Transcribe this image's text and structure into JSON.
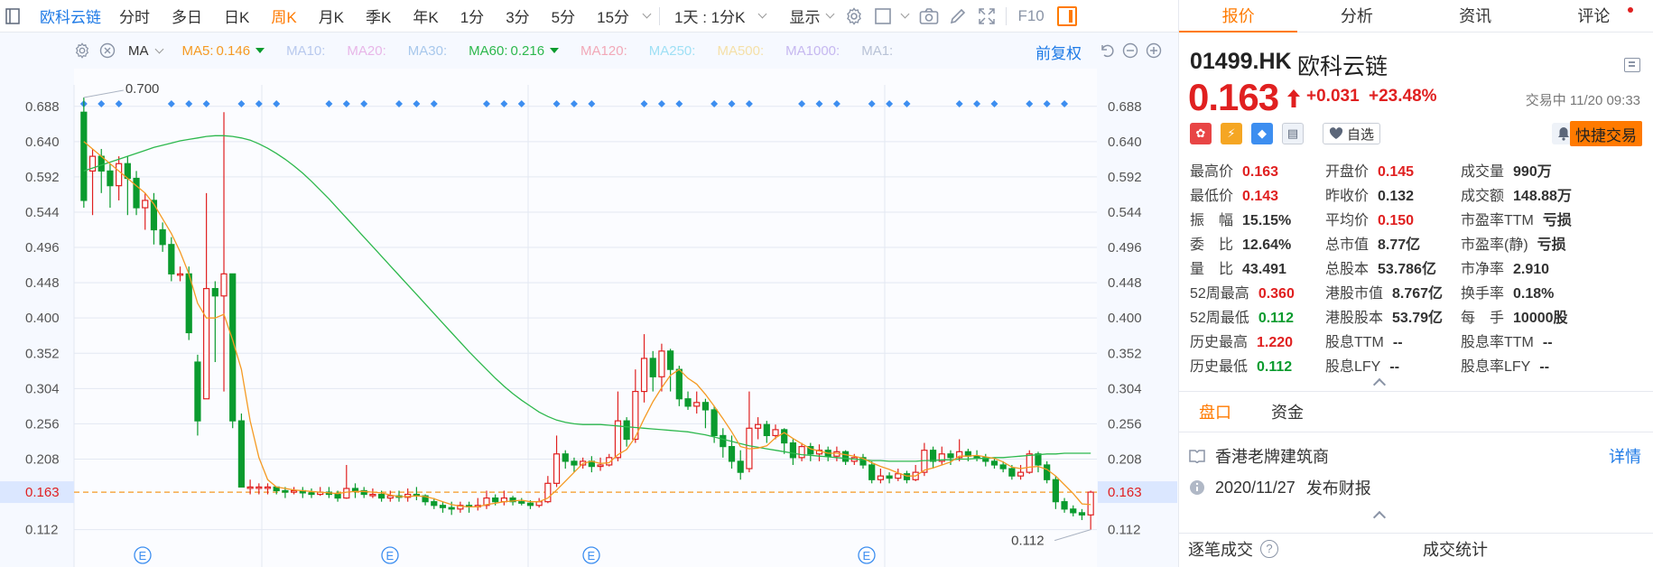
{
  "toolbar": {
    "stock_name": "欧科云链",
    "periods": [
      "分时",
      "多日",
      "日K",
      "周K",
      "月K",
      "季K",
      "年K",
      "1分",
      "3分",
      "5分",
      "15分"
    ],
    "active_period": "周K",
    "range_label": "1天 : 1分K",
    "display_label": "显示",
    "f10_label": "F10"
  },
  "ma_bar": {
    "label": "MA",
    "items": [
      {
        "label": "MA5:",
        "value": "0.146",
        "color": "#f59a23",
        "arrow": true
      },
      {
        "label": "MA10:",
        "value": "",
        "color": "#b8c9ee",
        "arrow": false
      },
      {
        "label": "MA20:",
        "value": "",
        "color": "#e8b6e8",
        "arrow": false
      },
      {
        "label": "MA30:",
        "value": "",
        "color": "#a8c8ec",
        "arrow": false
      },
      {
        "label": "MA60:",
        "value": "0.216",
        "color": "#2db84d",
        "arrow": true
      },
      {
        "label": "MA120:",
        "value": "",
        "color": "#f2a9b8",
        "arrow": false
      },
      {
        "label": "MA250:",
        "value": "",
        "color": "#9fe0f5",
        "arrow": false
      },
      {
        "label": "MA500:",
        "value": "",
        "color": "#f5e0a8",
        "arrow": false
      },
      {
        "label": "MA1000:",
        "value": "",
        "color": "#c6b8f0",
        "arrow": false
      },
      {
        "label": "MA1:",
        "value": "",
        "color": "#b8c2d6",
        "arrow": false
      }
    ],
    "adjust_label": "前复权"
  },
  "chart_data": {
    "type": "candlestick",
    "period": "周K",
    "y_ticks": [
      "0.688",
      "0.640",
      "0.592",
      "0.544",
      "0.496",
      "0.448",
      "0.400",
      "0.352",
      "0.304",
      "0.256",
      "0.208",
      "0.163",
      "0.112"
    ],
    "y_ticks_num": [
      0.688,
      0.64,
      0.592,
      0.544,
      0.496,
      0.448,
      0.4,
      0.352,
      0.304,
      0.256,
      0.208,
      0.163,
      0.112
    ],
    "ylim": [
      0.098,
      0.7
    ],
    "current_price": "0.163",
    "high_label": "0.700",
    "low_label": "0.112",
    "event_marker_label": "E",
    "candles": [
      [
        0.68,
        0.56,
        0.7,
        0.55
      ],
      [
        0.6,
        0.62,
        0.63,
        0.54
      ],
      [
        0.62,
        0.6,
        0.63,
        0.57
      ],
      [
        0.6,
        0.58,
        0.61,
        0.55
      ],
      [
        0.58,
        0.61,
        0.62,
        0.56
      ],
      [
        0.61,
        0.59,
        0.62,
        0.54
      ],
      [
        0.59,
        0.55,
        0.6,
        0.54
      ],
      [
        0.55,
        0.56,
        0.57,
        0.52
      ],
      [
        0.56,
        0.52,
        0.57,
        0.5
      ],
      [
        0.52,
        0.5,
        0.53,
        0.49
      ],
      [
        0.5,
        0.46,
        0.51,
        0.45
      ],
      [
        0.46,
        0.46,
        0.47,
        0.45
      ],
      [
        0.46,
        0.38,
        0.47,
        0.37
      ],
      [
        0.34,
        0.26,
        0.35,
        0.24
      ],
      [
        0.29,
        0.44,
        0.57,
        0.29
      ],
      [
        0.44,
        0.43,
        0.45,
        0.34
      ],
      [
        0.43,
        0.46,
        0.68,
        0.3
      ],
      [
        0.46,
        0.26,
        0.46,
        0.25
      ],
      [
        0.26,
        0.17,
        0.27,
        0.17
      ],
      [
        0.17,
        0.17,
        0.18,
        0.16
      ],
      [
        0.17,
        0.17,
        0.175,
        0.16
      ],
      [
        0.17,
        0.17,
        0.175,
        0.16
      ],
      [
        0.17,
        0.165,
        0.17,
        0.16
      ],
      [
        0.165,
        0.163,
        0.17,
        0.155
      ],
      [
        0.163,
        0.165,
        0.17,
        0.16
      ],
      [
        0.165,
        0.162,
        0.17,
        0.155
      ],
      [
        0.162,
        0.16,
        0.168,
        0.155
      ],
      [
        0.16,
        0.163,
        0.17,
        0.158
      ],
      [
        0.163,
        0.16,
        0.17,
        0.155
      ],
      [
        0.16,
        0.155,
        0.165,
        0.15
      ],
      [
        0.155,
        0.168,
        0.2,
        0.154
      ],
      [
        0.168,
        0.165,
        0.175,
        0.155
      ],
      [
        0.165,
        0.16,
        0.17,
        0.155
      ],
      [
        0.16,
        0.16,
        0.168,
        0.155
      ],
      [
        0.16,
        0.155,
        0.165,
        0.15
      ],
      [
        0.155,
        0.158,
        0.165,
        0.15
      ],
      [
        0.158,
        0.156,
        0.165,
        0.15
      ],
      [
        0.156,
        0.16,
        0.168,
        0.15
      ],
      [
        0.16,
        0.158,
        0.17,
        0.152
      ],
      [
        0.158,
        0.15,
        0.16,
        0.145
      ],
      [
        0.15,
        0.145,
        0.155,
        0.14
      ],
      [
        0.145,
        0.142,
        0.15,
        0.135
      ],
      [
        0.142,
        0.14,
        0.15,
        0.132
      ],
      [
        0.14,
        0.145,
        0.15,
        0.135
      ],
      [
        0.145,
        0.143,
        0.15,
        0.135
      ],
      [
        0.143,
        0.145,
        0.155,
        0.138
      ],
      [
        0.145,
        0.155,
        0.165,
        0.14
      ],
      [
        0.155,
        0.15,
        0.16,
        0.145
      ],
      [
        0.15,
        0.155,
        0.165,
        0.145
      ],
      [
        0.155,
        0.15,
        0.158,
        0.145
      ],
      [
        0.15,
        0.148,
        0.155,
        0.145
      ],
      [
        0.148,
        0.145,
        0.152,
        0.14
      ],
      [
        0.145,
        0.15,
        0.155,
        0.142
      ],
      [
        0.15,
        0.175,
        0.185,
        0.148
      ],
      [
        0.175,
        0.215,
        0.24,
        0.17
      ],
      [
        0.215,
        0.205,
        0.22,
        0.195
      ],
      [
        0.205,
        0.2,
        0.21,
        0.19
      ],
      [
        0.2,
        0.205,
        0.21,
        0.195
      ],
      [
        0.205,
        0.198,
        0.212,
        0.19
      ],
      [
        0.198,
        0.2,
        0.21,
        0.192
      ],
      [
        0.2,
        0.21,
        0.215,
        0.198
      ],
      [
        0.21,
        0.26,
        0.3,
        0.205
      ],
      [
        0.26,
        0.235,
        0.265,
        0.225
      ],
      [
        0.235,
        0.3,
        0.33,
        0.23
      ],
      [
        0.3,
        0.345,
        0.378,
        0.285
      ],
      [
        0.345,
        0.32,
        0.355,
        0.3
      ],
      [
        0.32,
        0.355,
        0.365,
        0.3
      ],
      [
        0.355,
        0.33,
        0.358,
        0.3
      ],
      [
        0.33,
        0.29,
        0.335,
        0.28
      ],
      [
        0.29,
        0.28,
        0.3,
        0.275
      ],
      [
        0.28,
        0.285,
        0.3,
        0.27
      ],
      [
        0.285,
        0.275,
        0.29,
        0.25
      ],
      [
        0.275,
        0.24,
        0.28,
        0.23
      ],
      [
        0.24,
        0.225,
        0.25,
        0.21
      ],
      [
        0.225,
        0.205,
        0.24,
        0.195
      ],
      [
        0.205,
        0.19,
        0.22,
        0.18
      ],
      [
        0.195,
        0.25,
        0.3,
        0.19
      ],
      [
        0.25,
        0.255,
        0.265,
        0.235
      ],
      [
        0.255,
        0.24,
        0.26,
        0.23
      ],
      [
        0.24,
        0.248,
        0.255,
        0.235
      ],
      [
        0.248,
        0.23,
        0.25,
        0.215
      ],
      [
        0.23,
        0.21,
        0.235,
        0.2
      ],
      [
        0.21,
        0.225,
        0.23,
        0.205
      ],
      [
        0.225,
        0.215,
        0.23,
        0.205
      ],
      [
        0.215,
        0.22,
        0.228,
        0.205
      ],
      [
        0.22,
        0.212,
        0.225,
        0.205
      ],
      [
        0.212,
        0.218,
        0.225,
        0.205
      ],
      [
        0.218,
        0.205,
        0.22,
        0.2
      ],
      [
        0.205,
        0.21,
        0.215,
        0.2
      ],
      [
        0.21,
        0.2,
        0.215,
        0.195
      ],
      [
        0.2,
        0.18,
        0.205,
        0.175
      ],
      [
        0.18,
        0.185,
        0.195,
        0.175
      ],
      [
        0.185,
        0.182,
        0.19,
        0.175
      ],
      [
        0.182,
        0.188,
        0.195,
        0.178
      ],
      [
        0.188,
        0.18,
        0.192,
        0.175
      ],
      [
        0.18,
        0.19,
        0.2,
        0.178
      ],
      [
        0.19,
        0.22,
        0.23,
        0.185
      ],
      [
        0.22,
        0.205,
        0.225,
        0.195
      ],
      [
        0.205,
        0.215,
        0.225,
        0.2
      ],
      [
        0.215,
        0.21,
        0.22,
        0.2
      ],
      [
        0.21,
        0.218,
        0.235,
        0.205
      ],
      [
        0.218,
        0.212,
        0.222,
        0.205
      ],
      [
        0.212,
        0.21,
        0.22,
        0.205
      ],
      [
        0.21,
        0.205,
        0.215,
        0.198
      ],
      [
        0.205,
        0.2,
        0.21,
        0.195
      ],
      [
        0.2,
        0.195,
        0.205,
        0.19
      ],
      [
        0.195,
        0.185,
        0.2,
        0.18
      ],
      [
        0.185,
        0.19,
        0.2,
        0.18
      ],
      [
        0.19,
        0.215,
        0.22,
        0.188
      ],
      [
        0.215,
        0.2,
        0.218,
        0.19
      ],
      [
        0.2,
        0.18,
        0.205,
        0.175
      ],
      [
        0.18,
        0.15,
        0.185,
        0.14
      ],
      [
        0.15,
        0.14,
        0.155,
        0.135
      ],
      [
        0.14,
        0.135,
        0.145,
        0.13
      ],
      [
        0.135,
        0.132,
        0.14,
        0.125
      ],
      [
        0.132,
        0.163,
        0.165,
        0.112
      ]
    ],
    "ma5": [
      0.64,
      0.63,
      0.62,
      0.61,
      0.6,
      0.59,
      0.58,
      0.57,
      0.555,
      0.535,
      0.515,
      0.49,
      0.46,
      0.42,
      0.4,
      0.4,
      0.405,
      0.37,
      0.33,
      0.26,
      0.21,
      0.18,
      0.17,
      0.168,
      0.166,
      0.165,
      0.164,
      0.163,
      0.162,
      0.161,
      0.163,
      0.164,
      0.164,
      0.163,
      0.162,
      0.159,
      0.157,
      0.157,
      0.158,
      0.157,
      0.154,
      0.15,
      0.146,
      0.144,
      0.143,
      0.143,
      0.146,
      0.148,
      0.15,
      0.151,
      0.152,
      0.15,
      0.15,
      0.155,
      0.166,
      0.178,
      0.19,
      0.202,
      0.205,
      0.202,
      0.203,
      0.214,
      0.221,
      0.238,
      0.263,
      0.286,
      0.305,
      0.322,
      0.33,
      0.318,
      0.31,
      0.296,
      0.28,
      0.263,
      0.245,
      0.225,
      0.222,
      0.223,
      0.226,
      0.237,
      0.244,
      0.236,
      0.229,
      0.222,
      0.219,
      0.216,
      0.216,
      0.214,
      0.212,
      0.209,
      0.203,
      0.198,
      0.194,
      0.189,
      0.185,
      0.185,
      0.193,
      0.196,
      0.2,
      0.204,
      0.212,
      0.212,
      0.213,
      0.211,
      0.209,
      0.204,
      0.197,
      0.195,
      0.197,
      0.198,
      0.194,
      0.185,
      0.173,
      0.161,
      0.147,
      0.146
    ],
    "ma60": [
      0.6,
      0.604,
      0.608,
      0.612,
      0.616,
      0.62,
      0.624,
      0.628,
      0.632,
      0.635,
      0.638,
      0.641,
      0.643,
      0.645,
      0.647,
      0.648,
      0.648,
      0.647,
      0.645,
      0.642,
      0.637,
      0.631,
      0.624,
      0.616,
      0.607,
      0.597,
      0.586,
      0.574,
      0.562,
      0.549,
      0.536,
      0.523,
      0.51,
      0.497,
      0.484,
      0.471,
      0.458,
      0.445,
      0.432,
      0.419,
      0.406,
      0.393,
      0.38,
      0.367,
      0.354,
      0.342,
      0.33,
      0.318,
      0.307,
      0.297,
      0.288,
      0.28,
      0.272,
      0.266,
      0.261,
      0.258,
      0.256,
      0.255,
      0.255,
      0.255,
      0.254,
      0.253,
      0.252,
      0.251,
      0.25,
      0.249,
      0.248,
      0.247,
      0.246,
      0.245,
      0.243,
      0.241,
      0.238,
      0.235,
      0.232,
      0.229,
      0.226,
      0.224,
      0.222,
      0.22,
      0.218,
      0.216,
      0.214,
      0.213,
      0.212,
      0.211,
      0.21,
      0.209,
      0.208,
      0.207,
      0.206,
      0.206,
      0.205,
      0.205,
      0.205,
      0.205,
      0.206,
      0.206,
      0.207,
      0.207,
      0.208,
      0.208,
      0.209,
      0.209,
      0.21,
      0.21,
      0.211,
      0.212,
      0.213,
      0.214,
      0.215,
      0.215,
      0.216,
      0.216,
      0.216,
      0.216
    ]
  },
  "quote": {
    "tabs": [
      "报价",
      "分析",
      "资讯",
      "评论"
    ],
    "active_tab": "报价",
    "code": "01499.HK",
    "name": "欧科云链",
    "price": "0.163",
    "change": "+0.031",
    "change_pct": "+23.48%",
    "status": "交易中 11/20 09:33",
    "watch_label": "自选",
    "quick_trade_label": "快捷交易",
    "fields": [
      [
        {
          "label": "最高价",
          "value": "0.163",
          "color": "red"
        },
        {
          "label": "开盘价",
          "value": "0.145",
          "color": "red"
        },
        {
          "label": "成交量",
          "value": "990万",
          "color": "dark"
        }
      ],
      [
        {
          "label": "最低价",
          "value": "0.143",
          "color": "red"
        },
        {
          "label": "昨收价",
          "value": "0.132",
          "color": "dark"
        },
        {
          "label": "成交额",
          "value": "148.88万",
          "color": "dark"
        }
      ],
      [
        {
          "label": "振　幅",
          "value": "15.15%",
          "color": "dark"
        },
        {
          "label": "平均价",
          "value": "0.150",
          "color": "red"
        },
        {
          "label": "市盈率TTM",
          "value": "亏损",
          "color": "dark"
        }
      ],
      [
        {
          "label": "委　比",
          "value": "12.64%",
          "color": "dark"
        },
        {
          "label": "总市值",
          "value": "8.77亿",
          "color": "dark"
        },
        {
          "label": "市盈率(静)",
          "value": "亏损",
          "color": "dark"
        }
      ],
      [
        {
          "label": "量　比",
          "value": "43.491",
          "color": "dark"
        },
        {
          "label": "总股本",
          "value": "53.786亿",
          "color": "dark"
        },
        {
          "label": "市净率",
          "value": "2.910",
          "color": "dark"
        }
      ],
      [
        {
          "label": "52周最高",
          "value": "0.360",
          "color": "red"
        },
        {
          "label": "港股市值",
          "value": "8.767亿",
          "color": "dark"
        },
        {
          "label": "换手率",
          "value": "0.18%",
          "color": "dark"
        }
      ],
      [
        {
          "label": "52周最低",
          "value": "0.112",
          "color": "green"
        },
        {
          "label": "港股股本",
          "value": "53.79亿",
          "color": "dark"
        },
        {
          "label": "每　手",
          "value": "10000股",
          "color": "dark"
        }
      ],
      [
        {
          "label": "历史最高",
          "value": "1.220",
          "color": "red"
        },
        {
          "label": "股息TTM",
          "value": "--",
          "color": "dark"
        },
        {
          "label": "股息率TTM",
          "value": "--",
          "color": "dark"
        }
      ],
      [
        {
          "label": "历史最低",
          "value": "0.112",
          "color": "green"
        },
        {
          "label": "股息LFY",
          "value": "--",
          "color": "dark"
        },
        {
          "label": "股息率LFY",
          "value": "--",
          "color": "dark"
        }
      ]
    ],
    "sub_tabs": [
      "盘口",
      "资金"
    ],
    "active_sub_tab": "盘口",
    "company_tag": "香港老牌建筑商",
    "detail_label": "详情",
    "report_date": "2020/11/27",
    "report_label": "发布财报",
    "trade_list_label": "逐笔成交",
    "trade_stats_label": "成交统计"
  },
  "colors": {
    "up": "#e02020",
    "down": "#0a9b2e",
    "accent": "#ff7a00",
    "link": "#1e7ae6"
  }
}
